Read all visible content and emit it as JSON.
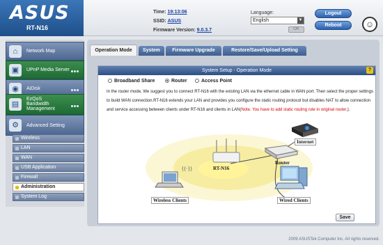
{
  "header": {
    "logo": "ASUS",
    "model": "RT-N16",
    "time_label": "Time:",
    "time_value": "19:13:06",
    "ssid_label": "SSID:",
    "ssid_value": "ASUS",
    "firmware_label": "Firmware Version:",
    "firmware_value": "9.0.3.7",
    "language_label": "Language:",
    "language_value": "English",
    "ok_label": "OK",
    "logout_label": "Logout",
    "reboot_label": "Reboot"
  },
  "sidebar": {
    "main_items": [
      {
        "label": "Network Map",
        "icon": "network-icon"
      },
      {
        "label": "UPnP Media Server",
        "icon": "media-server-icon"
      },
      {
        "label": "AiDisk",
        "icon": "disk-icon"
      },
      {
        "label": "EzQoS Bandwidth Management",
        "label_line1": "EzQoS",
        "label_line2": "Bandwidth",
        "label_line3": "Management",
        "icon": "qos-icon"
      },
      {
        "label": "Advanced Setting",
        "icon": "settings-icon"
      }
    ],
    "sub_items": [
      "Wireless",
      "LAN",
      "WAN",
      "USB Application",
      "Firewall",
      "Administration",
      "System Log"
    ]
  },
  "tabs": [
    "Operation Mode",
    "System",
    "Firmware Upgrade",
    "Restore/Save/Upload Setting"
  ],
  "panel": {
    "title": "System Setup - Operation Mode",
    "help": "?",
    "modes": [
      "Broadband Share",
      "Router",
      "Access Point"
    ],
    "selected_mode": "Router",
    "description_main": "In the router mode, We suggest you to connect RT-N16 with the existing LAN via the ethernet cable in WAN port. Then select the proper settings to build WAN connection.RT-N16 extends your LAN and provides you configure the static routing protocol but disables NAT to allow connection and service accessing between clients under RT-N16 and clients in LAN(",
    "description_note": "Note. You have to add static routing rule in original router.",
    "description_end": ")."
  },
  "diagram": {
    "router_label": "RT-N16",
    "internet_label": "Internet",
    "upstream_router_label": "Router",
    "wireless_clients_label": "Wireless Clients",
    "wired_clients_label": "Wired Clients"
  },
  "save_label": "Save",
  "footer": "2009 ASUSTek Computer Inc. All rights reserved.",
  "colors": {
    "accent": "#2e4f82",
    "brand": "#1e4f8a",
    "note": "#d40000"
  }
}
